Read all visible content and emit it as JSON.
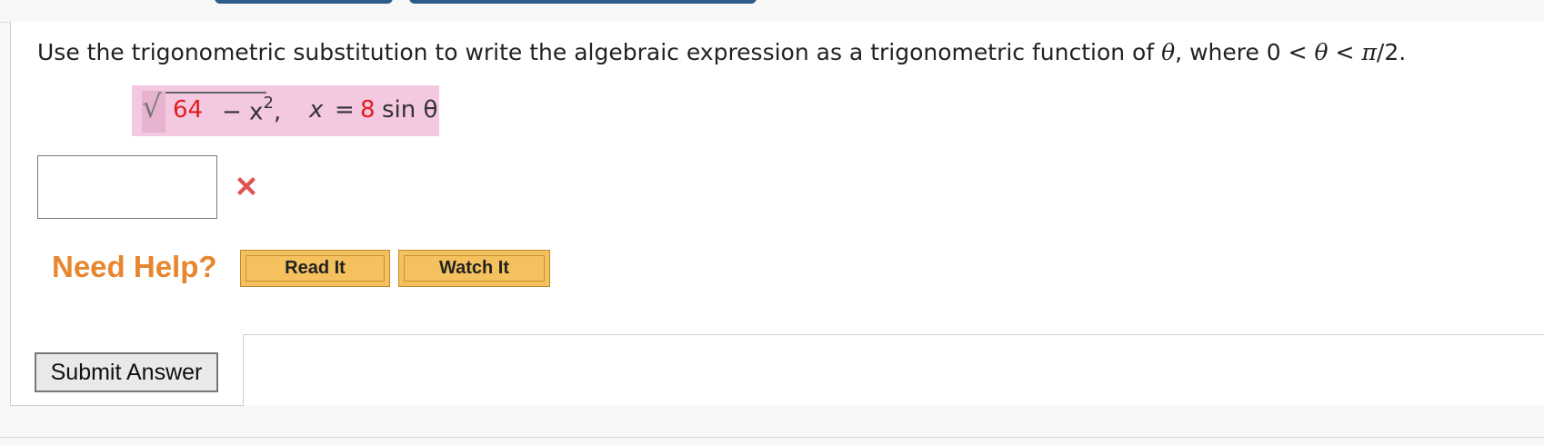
{
  "question": {
    "text_main": "Use the trigonometric substitution to write the algebraic expression as a trigonometric function of ",
    "theta": "θ",
    "text_mid": ", where 0 < ",
    "theta2": "θ",
    "text_mid2": " < ",
    "pi": "π",
    "text_end": "/2."
  },
  "expression": {
    "radical_sign": "√",
    "number": "64",
    "rest": " − x",
    "exponent": "2",
    "comma": ",",
    "x": "x",
    "eq": "=",
    "coef": "8",
    "sin": "sin θ"
  },
  "answer": {
    "value": "",
    "status": "incorrect",
    "status_color": "#e05353"
  },
  "help": {
    "label": "Need Help?",
    "read_label": "Read It",
    "watch_label": "Watch It"
  },
  "submit": {
    "label": "Submit Answer"
  },
  "colors": {
    "accent_red": "#e01e1e",
    "help_orange": "#e8862f",
    "button_gold": "#f4c15e",
    "highlight_pink": "#f4c8e0"
  }
}
